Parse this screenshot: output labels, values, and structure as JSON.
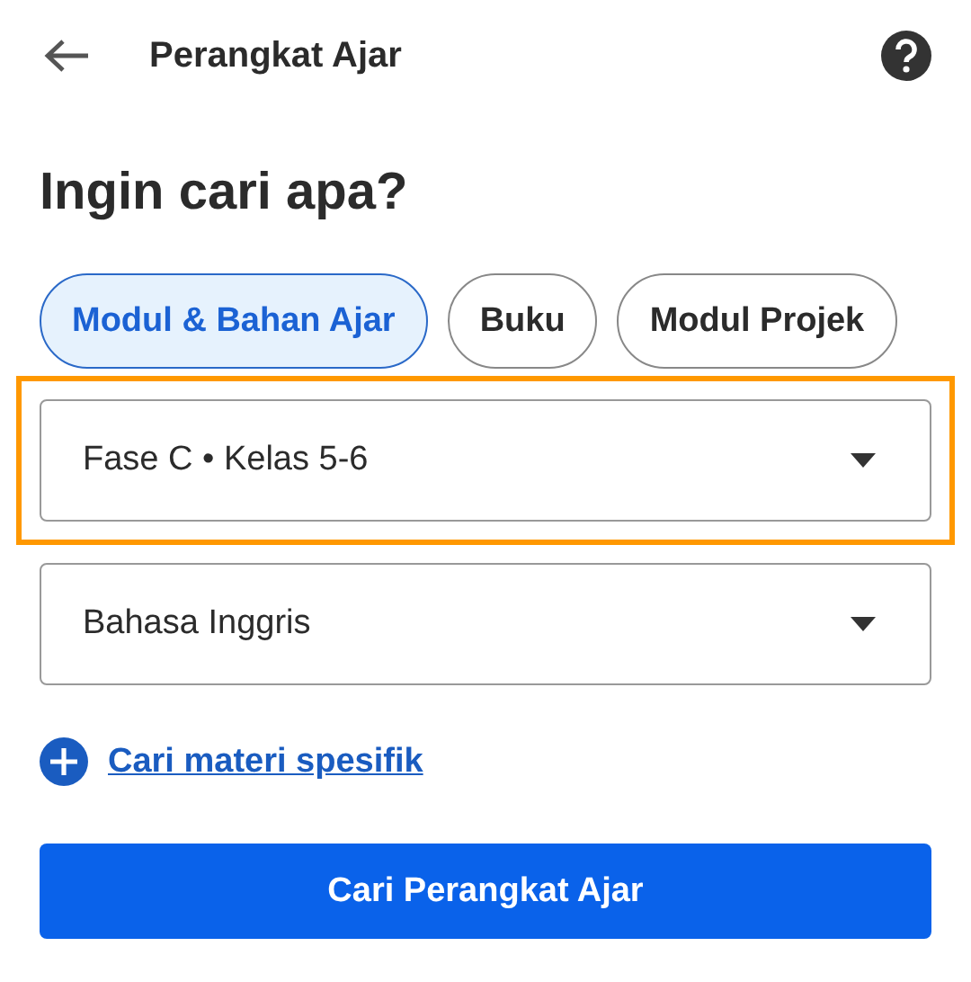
{
  "app_bar": {
    "title": "Perangkat Ajar"
  },
  "heading": "Ingin cari apa?",
  "chips": [
    {
      "label": "Modul & Bahan Ajar",
      "selected": true
    },
    {
      "label": "Buku",
      "selected": false
    },
    {
      "label": "Modul Projek",
      "selected": false
    }
  ],
  "dropdowns": [
    {
      "value": "Fase C • Kelas 5-6",
      "highlighted": true
    },
    {
      "value": "Bahasa Inggris",
      "highlighted": false
    }
  ],
  "add_link": "Cari materi spesifik",
  "submit_button": "Cari Perangkat Ajar"
}
